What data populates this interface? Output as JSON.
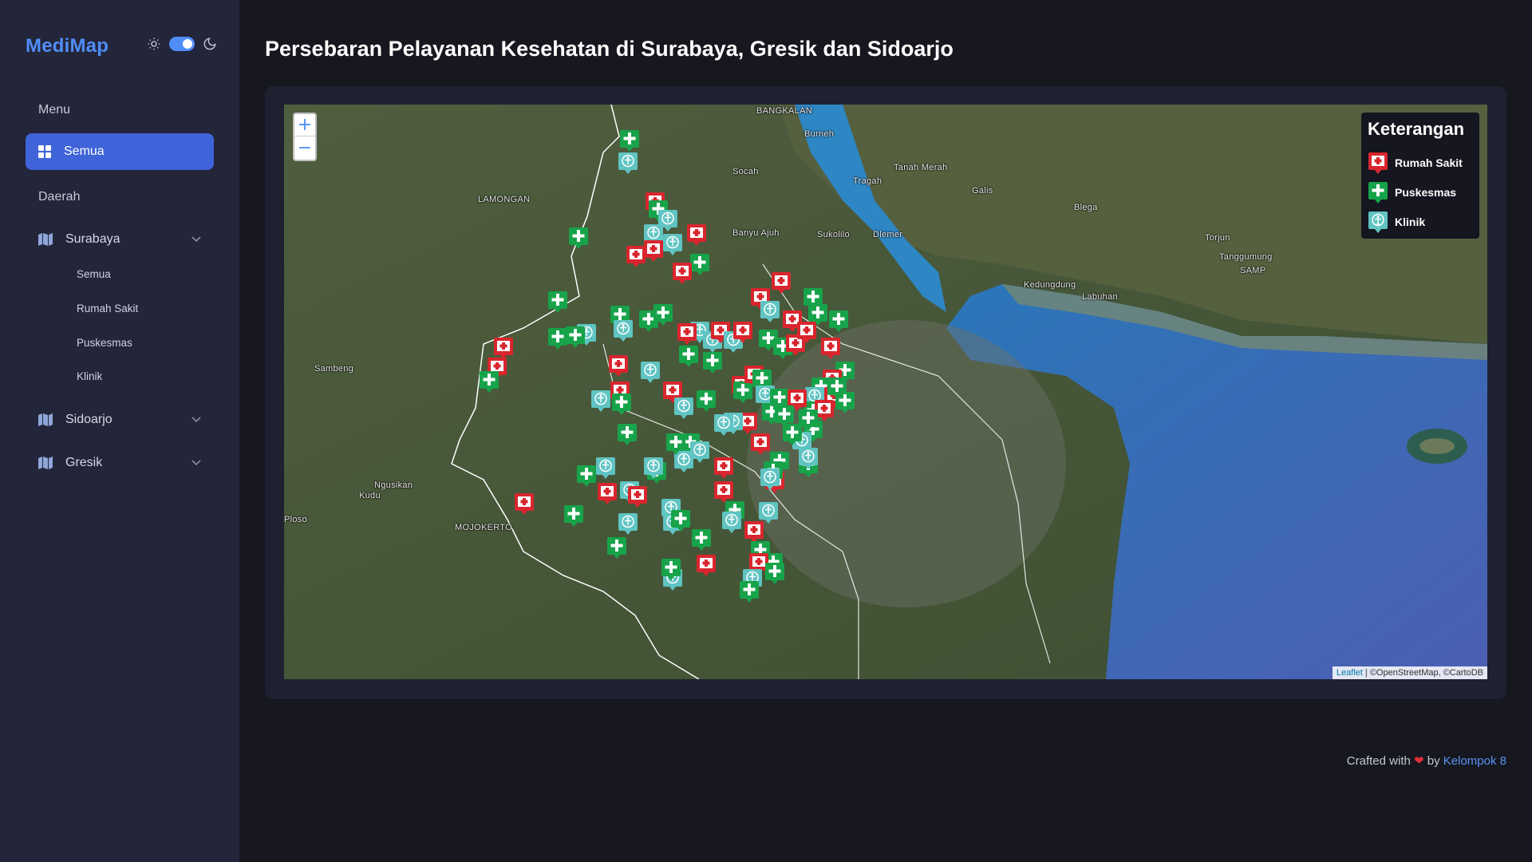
{
  "app": {
    "name": "MediMap"
  },
  "sidebar": {
    "menu_label": "Menu",
    "active_item": "Semua",
    "region_label": "Daerah",
    "regions": [
      {
        "label": "Surabaya",
        "subitems": [
          "Semua",
          "Rumah Sakit",
          "Puskesmas",
          "Klinik"
        ]
      },
      {
        "label": "Sidoarjo"
      },
      {
        "label": "Gresik"
      }
    ]
  },
  "main": {
    "title": "Persebaran Pelayanan Kesehatan di Surabaya, Gresik dan Sidoarjo"
  },
  "map": {
    "zoom_in": "+",
    "zoom_out": "−",
    "legend": {
      "title": "Keterangan",
      "items": [
        {
          "label": "Rumah Sakit",
          "icon": "hospital-icon",
          "color": "#d9262e"
        },
        {
          "label": "Puskesmas",
          "icon": "puskesmas-icon",
          "color": "#17a34a"
        },
        {
          "label": "Klinik",
          "icon": "clinic-icon",
          "color": "#5fc4c2"
        }
      ]
    },
    "attribution": {
      "leaflet": "Leaflet",
      "rest": " | ©OpenStreetMap, ©CartoDB"
    },
    "place_labels": [
      "BANGKALAN",
      "Burneh",
      "Socah",
      "Tanah Merah",
      "Tragah",
      "Galis",
      "Blega",
      "LAMONGAN",
      "Banyu Ajuh",
      "Sukolilo",
      "Dlemer",
      "Torjun",
      "Tanggumung",
      "SAMP",
      "Kedungdung",
      "Labuhan",
      "Sambeng",
      "Ngusikan",
      "Kudu",
      "MOJOKERTO",
      "Ploso"
    ]
  },
  "footer": {
    "prefix": "Crafted with",
    "heart": "❤",
    "by": "by",
    "author": "Kelompok 8"
  }
}
